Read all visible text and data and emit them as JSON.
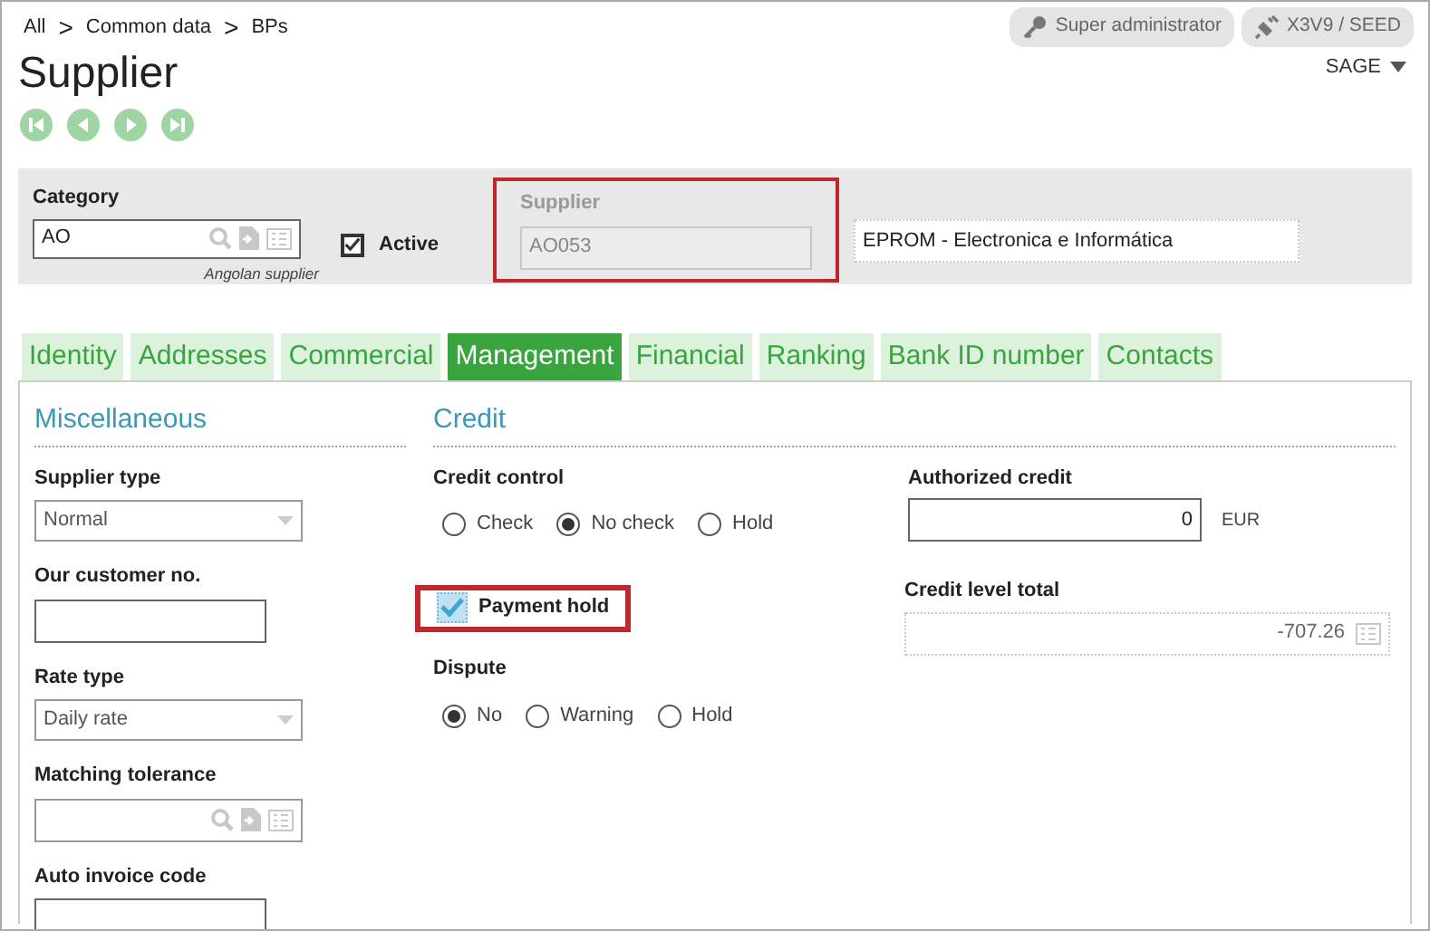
{
  "breadcrumb": [
    "All",
    "Common data",
    "BPs"
  ],
  "breadcrumb_separator": ">",
  "user_badges": [
    {
      "kind": "key",
      "label": "Super administrator"
    },
    {
      "kind": "plug",
      "label": "X3V9 / SEED"
    }
  ],
  "title": "Supplier",
  "company_menu": "SAGE",
  "nav_buttons": [
    {
      "kind": "first"
    },
    {
      "kind": "previous"
    },
    {
      "kind": "next"
    },
    {
      "kind": "last"
    }
  ],
  "header": {
    "category": {
      "label": "Category",
      "value": "AO",
      "hint": "Angolan supplier"
    },
    "active": {
      "label": "Active",
      "checked": true
    },
    "supplier": {
      "label": "Supplier",
      "value": "AO053",
      "disabled": true,
      "highlighted": true
    },
    "description": "EPROM - Electronica e Informática"
  },
  "tabs": [
    {
      "label": "Identity",
      "selected": false
    },
    {
      "label": "Addresses",
      "selected": false
    },
    {
      "label": "Commercial",
      "selected": false
    },
    {
      "label": "Management",
      "selected": true
    },
    {
      "label": "Financial",
      "selected": false
    },
    {
      "label": "Ranking",
      "selected": false
    },
    {
      "label": "Bank ID number",
      "selected": false
    },
    {
      "label": "Contacts",
      "selected": false
    }
  ],
  "miscellaneous": {
    "title": "Miscellaneous",
    "fields": [
      {
        "kind": "select",
        "label": "Supplier type",
        "value": "Normal"
      },
      {
        "kind": "text",
        "label": "Our customer no."
      },
      {
        "kind": "select",
        "label": "Rate type",
        "value": "Daily rate"
      },
      {
        "kind": "lookup",
        "label": "Matching tolerance"
      },
      {
        "kind": "text",
        "label": "Auto invoice code"
      }
    ]
  },
  "credit": {
    "title": "Credit",
    "credit_control": {
      "label": "Credit control",
      "options": [
        {
          "label": "Check",
          "selected": false
        },
        {
          "label": "No check",
          "selected": true
        },
        {
          "label": "Hold",
          "selected": false
        }
      ]
    },
    "payment_hold": {
      "label": "Payment hold",
      "checked": true,
      "highlighted": true
    },
    "dispute": {
      "label": "Dispute",
      "options": [
        {
          "label": "No",
          "selected": true
        },
        {
          "label": "Warning",
          "selected": false
        },
        {
          "label": "Hold",
          "selected": false
        }
      ]
    },
    "authorized_credit": {
      "label": "Authorized credit",
      "value": "0",
      "currency": "EUR"
    },
    "credit_level_total": {
      "label": "Credit level total",
      "value": "-707.26"
    }
  }
}
